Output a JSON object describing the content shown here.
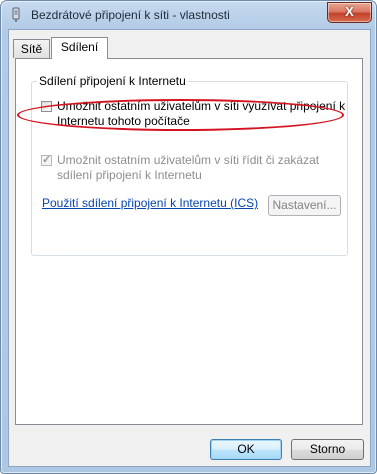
{
  "window": {
    "title": "Bezdrátové připojení k síti - vlastnosti",
    "close_label": "X"
  },
  "tabs": [
    {
      "label": "Sítě"
    },
    {
      "label": "Sdílení"
    }
  ],
  "sharing": {
    "group_title": "Sdílení připojení k Internetu",
    "allow_connect_label": "Umožnit ostatním uživatelům v síti využívat připojení k Internetu tohoto počítače",
    "allow_connect_checked": false,
    "allow_control_label": "Umožnit ostatním uživatelům v síti řídit či zakázat sdílení připojení k Internetu",
    "allow_control_checked": true,
    "ics_link": "Použití sdílení připojení k Internetu (ICS)",
    "settings_label": "Nastavení..."
  },
  "footer": {
    "ok_label": "OK",
    "cancel_label": "Storno"
  },
  "colors": {
    "highlight_ellipse": "#d51220",
    "link": "#0645ad"
  }
}
